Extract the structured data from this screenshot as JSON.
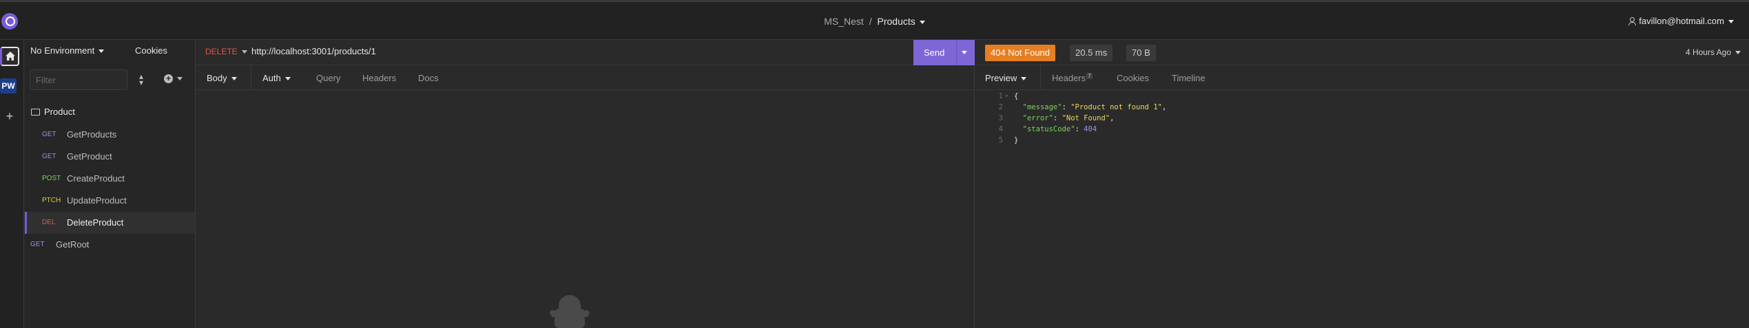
{
  "window": {
    "project": "MS_Nest",
    "separator": "/",
    "collection": "Products",
    "account": "favillon@hotmail.com"
  },
  "rail": {
    "workspace_badge": "PW",
    "add_label": "+"
  },
  "sidebar": {
    "environment": "No Environment",
    "cookies": "Cookies",
    "filter_placeholder": "Filter",
    "folder": "Product",
    "requests": [
      {
        "method": "GET",
        "name": "GetProducts"
      },
      {
        "method": "GET",
        "name": "GetProduct"
      },
      {
        "method": "POST",
        "name": "CreateProduct"
      },
      {
        "method": "PTCH",
        "name": "UpdateProduct"
      },
      {
        "method": "DEL",
        "name": "DeleteProduct"
      }
    ],
    "root_request": {
      "method": "GET",
      "name": "GetRoot"
    }
  },
  "request": {
    "method": "DELETE",
    "url": "http://localhost:3001/products/1",
    "send": "Send",
    "tabs": {
      "body": "Body",
      "auth": "Auth",
      "query": "Query",
      "headers": "Headers",
      "docs": "Docs"
    }
  },
  "response": {
    "status": "404 Not Found",
    "time": "20.5 ms",
    "size": "70 B",
    "age": "4 Hours Ago",
    "tabs": {
      "preview": "Preview",
      "headers": "Headers",
      "headers_count": "7",
      "cookies": "Cookies",
      "timeline": "Timeline"
    },
    "body_lines": [
      {
        "n": "1",
        "text": "{"
      },
      {
        "n": "2",
        "key": "\"message\"",
        "value": "\"Product not found 1\"",
        "tail": ","
      },
      {
        "n": "3",
        "key": "\"error\"",
        "value": "\"Not Found\"",
        "tail": ","
      },
      {
        "n": "4",
        "key": "\"statusCode\"",
        "number": "404",
        "tail": ""
      },
      {
        "n": "5",
        "text": "}"
      }
    ]
  },
  "colors": {
    "accent": "#7f66d6",
    "status_404": "#e67e22",
    "method_get": "#9c8ef0",
    "method_post": "#7fd05a",
    "method_patch": "#e8c83a",
    "method_delete": "#e0574f"
  },
  "icons": [
    "app-logo-icon",
    "home-icon",
    "plus-icon",
    "user-icon",
    "folder-icon",
    "sort-icon",
    "add-circle-icon",
    "chevron-down-icon"
  ]
}
